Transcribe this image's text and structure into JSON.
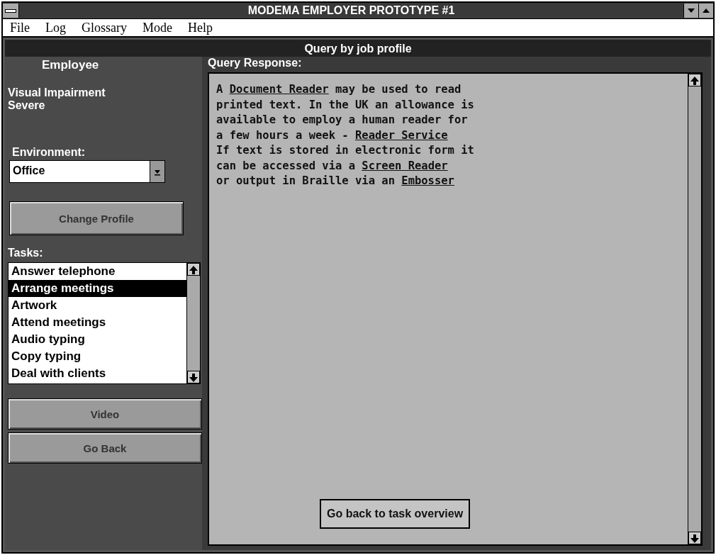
{
  "window": {
    "title": "MODEMA EMPLOYER PROTOTYPE #1"
  },
  "menu": [
    "File",
    "Log",
    "Glossary",
    "Mode",
    "Help"
  ],
  "panel_title": "Query by job profile",
  "employee": {
    "heading": "Employee",
    "impairment": "Visual Impairment",
    "severity": "Severe"
  },
  "environment": {
    "label": "Environment:",
    "value": "Office"
  },
  "change_profile": "Change Profile",
  "tasks": {
    "label": "Tasks:",
    "items": [
      {
        "label": "Answer telephone",
        "selected": false
      },
      {
        "label": "Arrange meetings",
        "selected": true
      },
      {
        "label": "Artwork",
        "selected": false
      },
      {
        "label": "Attend meetings",
        "selected": false
      },
      {
        "label": "Audio typing",
        "selected": false
      },
      {
        "label": "Copy typing",
        "selected": false
      },
      {
        "label": "Deal with clients",
        "selected": false
      }
    ]
  },
  "buttons": [
    "Video",
    "Go Back"
  ],
  "response": {
    "label": "Query Response:",
    "lines": [
      [
        {
          "kind": "text",
          "text": "A "
        },
        {
          "kind": "link",
          "text": "Document Reader"
        },
        {
          "kind": "text",
          "text": " may be used to read"
        }
      ],
      [
        {
          "kind": "text",
          "text": "printed text.  In the UK an allowance is"
        }
      ],
      [
        {
          "kind": "text",
          "text": "available to employ a human reader for"
        }
      ],
      [
        {
          "kind": "text",
          "text": "a few hours a week - "
        },
        {
          "kind": "link",
          "text": "Reader Service"
        }
      ],
      [
        {
          "kind": "text",
          "text": "If text is stored in electronic form it"
        }
      ],
      [
        {
          "kind": "text",
          "text": "can be accessed via a "
        },
        {
          "kind": "link",
          "text": "Screen Reader"
        }
      ],
      [
        {
          "kind": "text",
          "text": "or output in Braille via an "
        },
        {
          "kind": "link",
          "text": "Embosser"
        }
      ]
    ],
    "back_button": "Go back to task overview"
  }
}
